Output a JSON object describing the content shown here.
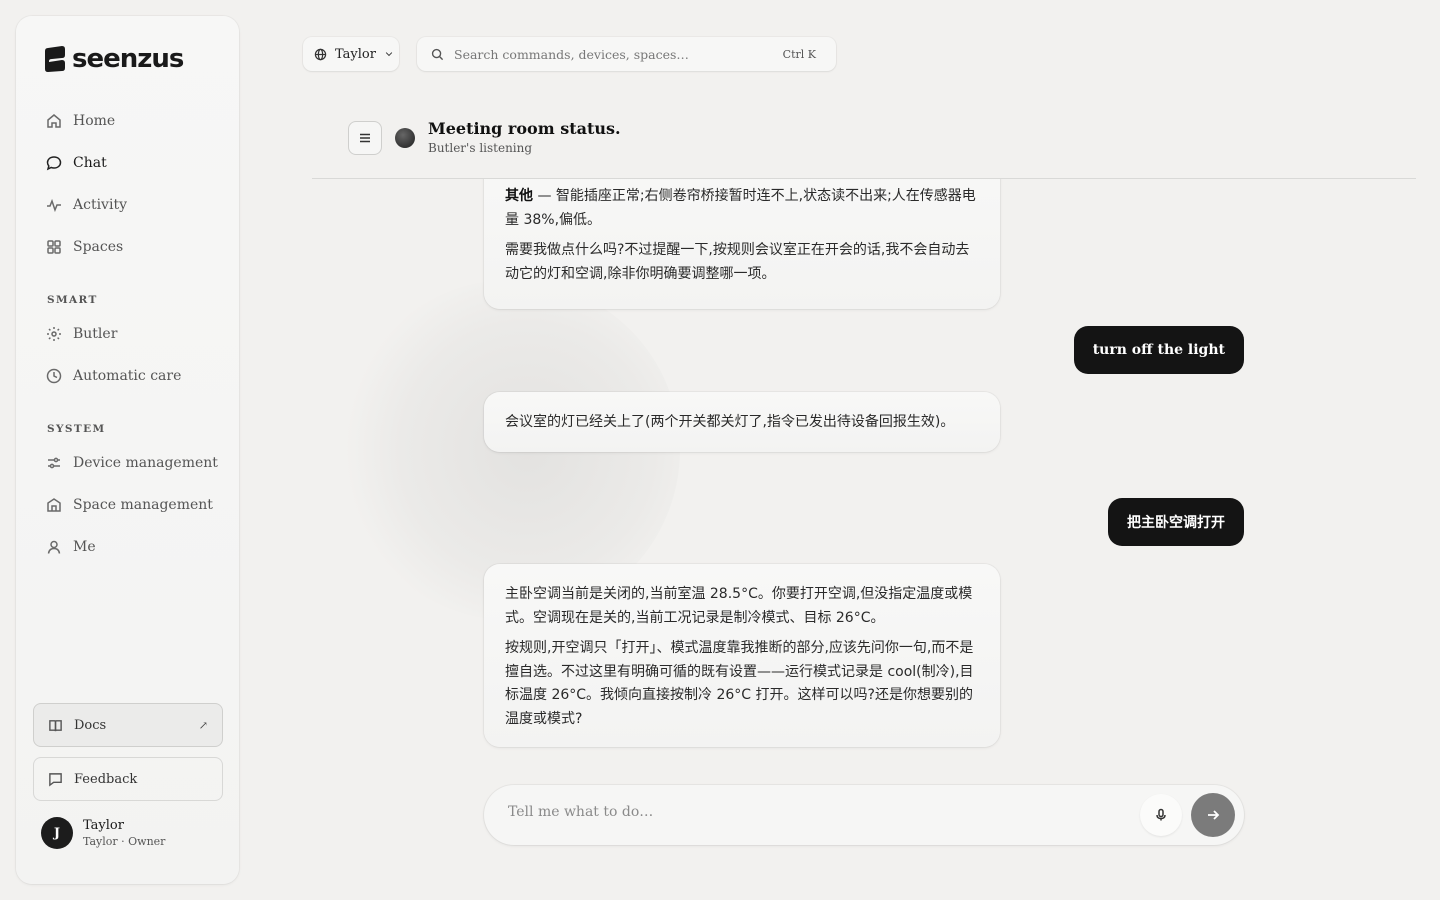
{
  "brand": {
    "name": "seenzus"
  },
  "sidebar": {
    "nav": [
      {
        "label": "Home",
        "icon": "home-icon"
      },
      {
        "label": "Chat",
        "icon": "chat-icon",
        "active": true
      },
      {
        "label": "Activity",
        "icon": "activity-icon"
      },
      {
        "label": "Spaces",
        "icon": "grid-icon"
      }
    ],
    "smart_label": "SMART",
    "smart": [
      {
        "label": "Butler",
        "icon": "sparkle-icon"
      },
      {
        "label": "Automatic care",
        "icon": "clock-icon"
      }
    ],
    "system_label": "SYSTEM",
    "system": [
      {
        "label": "Device management",
        "icon": "sliders-icon"
      },
      {
        "label": "Space management",
        "icon": "building-icon"
      },
      {
        "label": "Me",
        "icon": "user-icon"
      }
    ],
    "docs_label": "Docs",
    "docs_arrow": "↗",
    "feedback_label": "Feedback",
    "user": {
      "initial": "J",
      "name": "Taylor",
      "role": "Taylor · Owner"
    }
  },
  "topbar": {
    "user_switch": "Taylor",
    "search_placeholder": "Search commands, devices, spaces…",
    "search_shortcut": "Ctrl K"
  },
  "chat": {
    "title": "Meeting room status.",
    "subtitle": "Butler's listening",
    "messages": [
      {
        "role": "assistant",
        "label": "其他",
        "p1": " — 智能插座正常;右侧卷帘桥接暂时连不上,状态读不出来;人在传感器电量 38%,偏低。",
        "p2": "需要我做点什么吗?不过提醒一下,按规则会议室正在开会的话,我不会自动去动它的灯和空调,除非你明确要调整哪一项。"
      },
      {
        "role": "user",
        "text": "turn off the light"
      },
      {
        "role": "assistant",
        "p1": "会议室的灯已经关上了(两个开关都关灯了,指令已发出待设备回报生效)。"
      },
      {
        "role": "user",
        "text": "把主卧空调打开"
      },
      {
        "role": "assistant",
        "p1": "主卧空调当前是关闭的,当前室温 28.5°C。你要打开空调,但没指定温度或模式。空调现在是关的,当前工况记录是制冷模式、目标 26°C。",
        "p2": "按规则,开空调只「打开」、模式温度靠我推断的部分,应该先问你一句,而不是擅自选。不过这里有明确可循的既有设置——运行模式记录是 cool(制冷),目标温度 26°C。我倾向直接按制冷 26°C 打开。这样可以吗?还是你想要别的温度或模式?"
      }
    ],
    "composer_placeholder": "Tell me what to do…"
  },
  "colors": {
    "background": "#f2f1ef",
    "user_bubble": "#141414",
    "send_button": "#7b7b7b"
  }
}
